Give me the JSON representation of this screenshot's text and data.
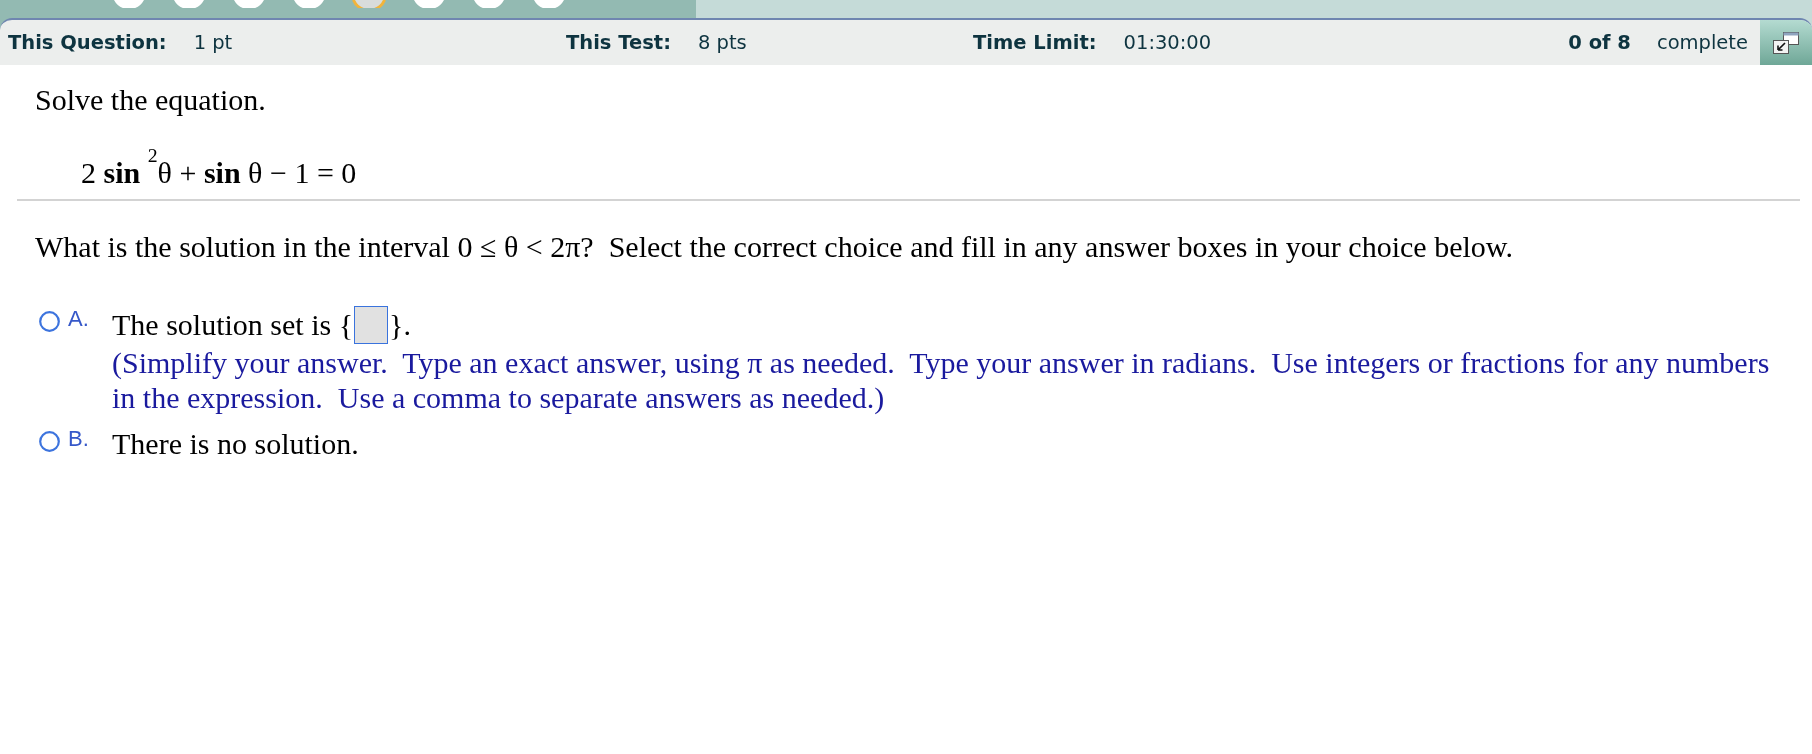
{
  "question_dots": [
    {
      "selected": false
    },
    {
      "selected": false
    },
    {
      "selected": false
    },
    {
      "selected": false
    },
    {
      "selected": true
    },
    {
      "selected": false
    },
    {
      "selected": false
    },
    {
      "selected": false
    }
  ],
  "header": {
    "fields": [
      {
        "label": "This Question:",
        "value": "1 pt"
      },
      {
        "label": "This Test:",
        "value": "8 pts"
      },
      {
        "label": "Time Limit:",
        "value": "01:30:00"
      }
    ],
    "progress": {
      "count": "0 of 8",
      "label": "complete"
    }
  },
  "instruction": "Solve the equation.",
  "equation": "2 **sin** $^{2}$θ + **sin** θ − 1 = 0",
  "question": "What is the solution in the interval 0 ≤ θ < 2π?  Select the correct choice and fill in any answer boxes in your choice below.",
  "options": [
    {
      "kind": "fill_in",
      "letter": "A.",
      "selected": false,
      "before": "The solution set is {",
      "after": "}.",
      "hint": "(Simplify your answer.  Type an exact answer, using π as needed.  Type your answer in radians.  Use integers or fractions for any numbers in the expression.  Use a comma to separate answers as needed.)"
    },
    {
      "kind": "text",
      "letter": "B.",
      "selected": false,
      "text": "There is no solution."
    }
  ]
}
